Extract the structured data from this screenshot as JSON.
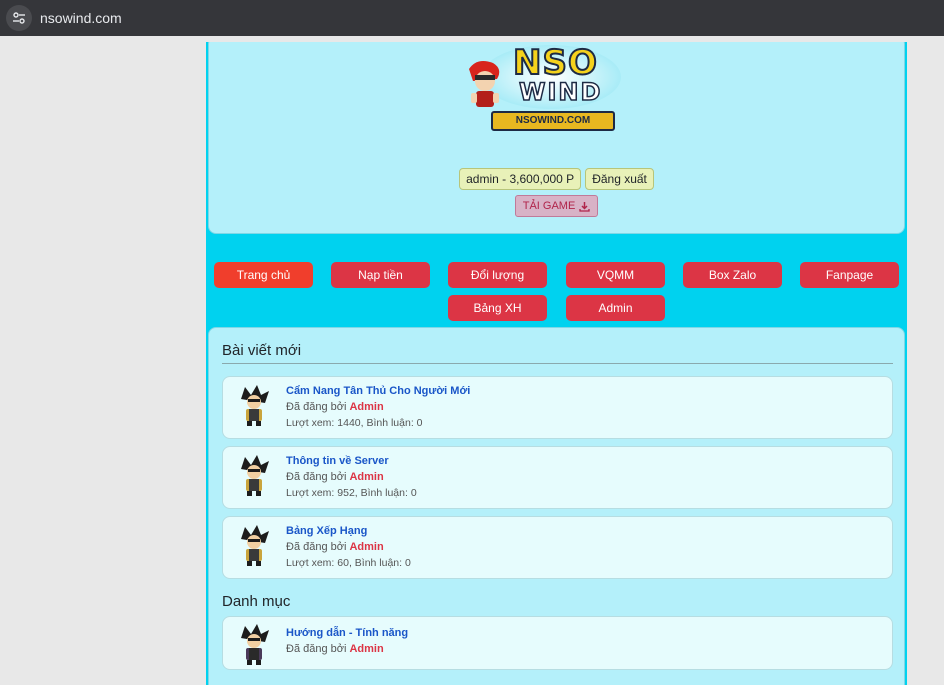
{
  "browser": {
    "url": "nsowind.com",
    "site_info_icon": "tune-icon"
  },
  "header": {
    "logo": {
      "top_text": "NSO",
      "bottom_text": "WIND",
      "banner_text": "NSOWIND.COM"
    },
    "user_info": "admin - 3,600,000 P",
    "logout_label": "Đăng xuất",
    "download_label": "TẢI GAME",
    "download_icon": "download-icon"
  },
  "nav": {
    "items": [
      {
        "label": "Trang chủ",
        "active": true
      },
      {
        "label": "Nạp tiền"
      },
      {
        "label": "Đổi lượng"
      },
      {
        "label": "VQMM"
      },
      {
        "label": "Box Zalo"
      },
      {
        "label": "Fanpage"
      },
      {
        "label": "Bảng XH"
      },
      {
        "label": "Admin"
      }
    ]
  },
  "sections": {
    "new_posts_title": "Bài viết mới",
    "categories_title": "Danh mục"
  },
  "posts": [
    {
      "title": "Cẩm Nang Tân Thủ Cho Người Mới",
      "posted_by": "Đã đăng bởi",
      "author": "Admin",
      "stats": "Lượt xem: 1440, Bình luận: 0"
    },
    {
      "title": "Thông tin về Server",
      "posted_by": "Đã đăng bởi",
      "author": "Admin",
      "stats": "Lượt xem: 952, Bình luận: 0"
    },
    {
      "title": "Bảng Xếp Hạng",
      "posted_by": "Đã đăng bởi",
      "author": "Admin",
      "stats": "Lượt xem: 60, Bình luận: 0"
    }
  ],
  "categories": [
    {
      "title": "Hướng dẫn - Tính năng",
      "posted_by": "Đã đăng bởi",
      "author": "Admin"
    }
  ],
  "colors": {
    "nav_button": "#dc3545",
    "nav_active": "#f03e2c",
    "page_bg": "#00d2ef",
    "panel_bg": "#b4f0fa",
    "link": "#1a56c8"
  }
}
